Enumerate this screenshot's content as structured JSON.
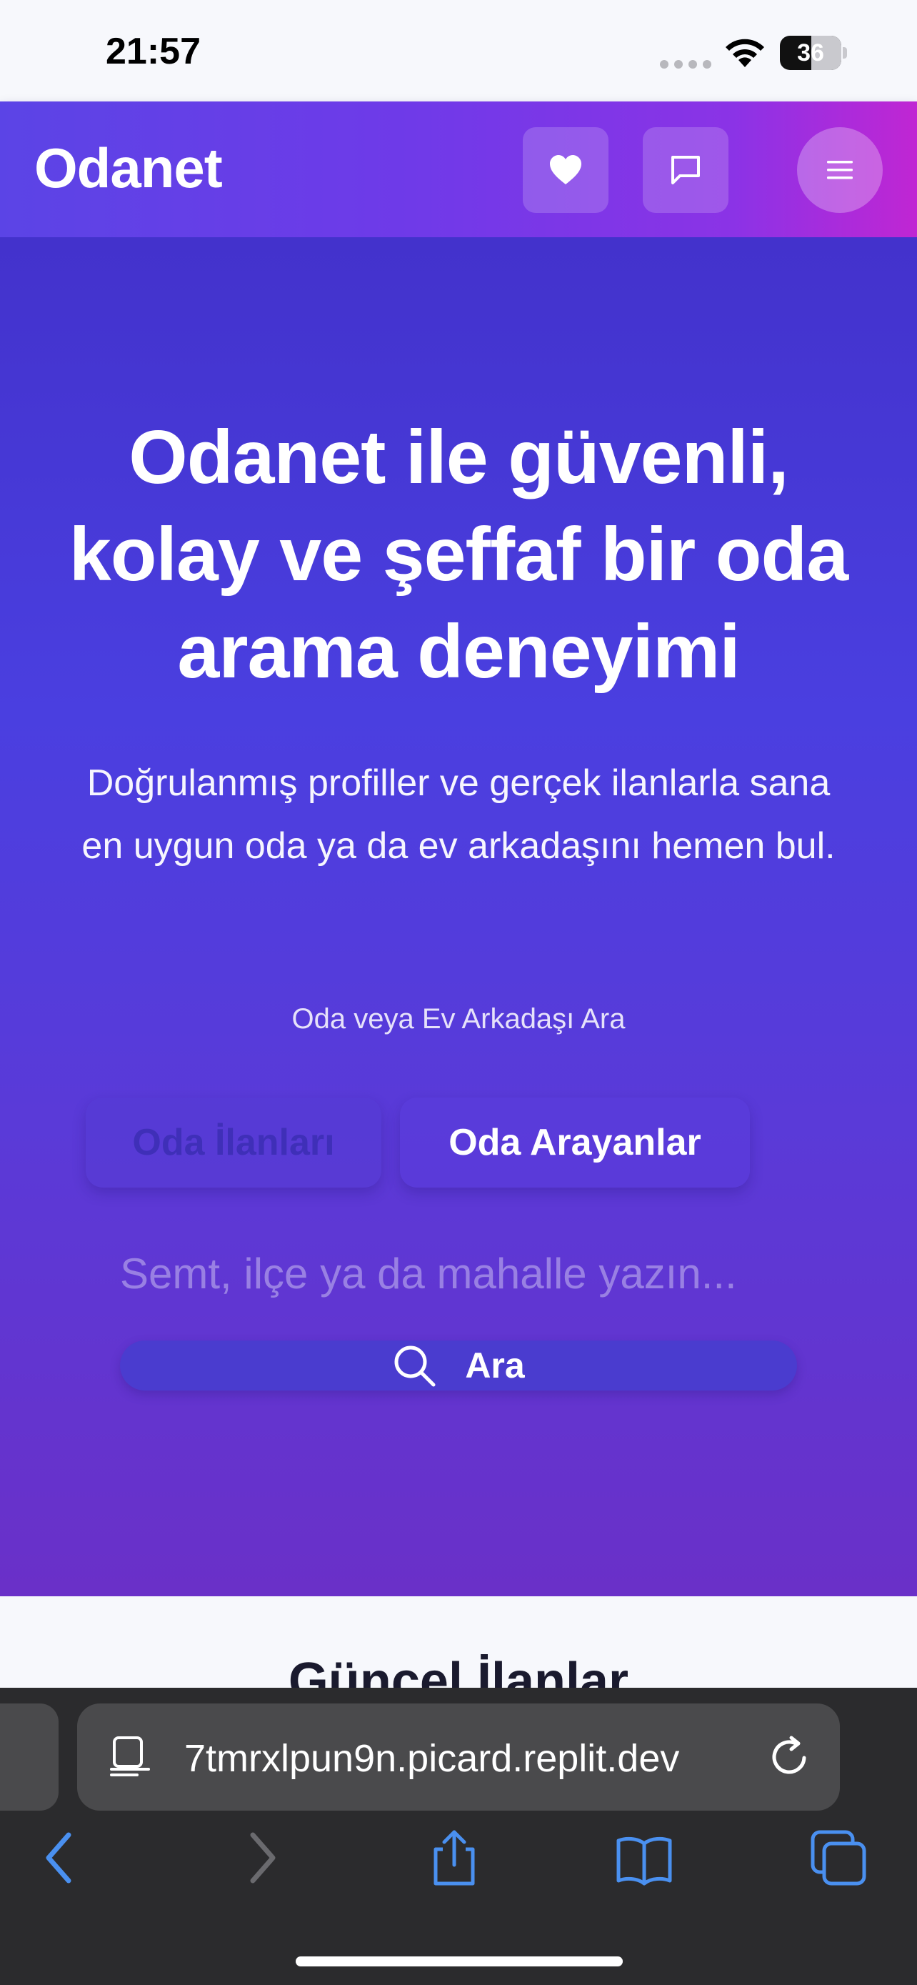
{
  "status_bar": {
    "time": "21:57",
    "battery": "36"
  },
  "header": {
    "brand": "Odanet",
    "icons": [
      "heart-icon",
      "message-icon",
      "menu-icon"
    ]
  },
  "hero": {
    "title": "Odanet ile güvenli, kolay ve şeffaf bir oda arama deneyimi",
    "subtitle": "Doğrulanmış profiller ve gerçek ilanlarla sana en uygun oda ya da ev arkadaşını hemen bul.",
    "search_label": "Oda veya Ev Arkadaşı Ara",
    "tabs": [
      {
        "label": "Oda İlanları"
      },
      {
        "label": "Oda Arayanlar"
      }
    ],
    "search_placeholder": "Semt, ilçe ya da mahalle yazın...",
    "search_button": "Ara"
  },
  "listings": {
    "title": "Güncel İlanlar"
  },
  "browser": {
    "url": "7tmrxlpun9n.picard.replit.dev"
  },
  "colors": {
    "header_start": "#5b44e6",
    "header_end": "#c026d3",
    "hero": "#4a3fe0"
  }
}
